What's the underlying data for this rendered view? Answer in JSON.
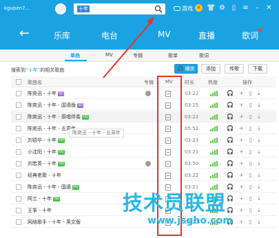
{
  "header": {
    "username": "kgupen7...",
    "search_term": "十年",
    "games_label": "游戏"
  },
  "nav": {
    "items": [
      {
        "label": "乐库"
      },
      {
        "label": "电台"
      },
      {
        "label": "MV"
      },
      {
        "label": "直播"
      },
      {
        "label": "歌词"
      }
    ]
  },
  "subtabs": [
    "单曲",
    "MV",
    "专辑",
    "歌单",
    "歌词"
  ],
  "result_info": {
    "prefix": "搜索到",
    "keyword": "“十年”",
    "suffix": "的相关歌曲"
  },
  "actions": {
    "play": "播放",
    "add": "添加",
    "send": "传歌",
    "download": "下载"
  },
  "table": {
    "headers": {
      "name": "歌曲名",
      "album": "专辑",
      "mv": "MV",
      "duration": "时长",
      "heat": "热度",
      "ops": "操作"
    },
    "rows": [
      {
        "name": "陈奕迅 - 十年",
        "tag": "SQ",
        "album": true,
        "duration": "03:22"
      },
      {
        "name": "陈奕迅 - 十年 - 国语版",
        "tag": "SQ",
        "album": false,
        "duration": "03:25"
      },
      {
        "name": "陈奕迅 - 十年 - 原唱伴奏",
        "tag": "HQ",
        "album": false,
        "duration": "03:22"
      },
      {
        "name": "陈奕迅 - 十年 - 五周年",
        "tag": "",
        "album": false,
        "duration": "05:52"
      },
      {
        "name": "刘德华 - 十年",
        "tag": "HQ",
        "album": false,
        "duration": "03:23"
      },
      {
        "name": "小沈阳 - 十年",
        "tag": "HQ",
        "album": false,
        "duration": "03:21"
      },
      {
        "name": "刘若英 - 十年",
        "tag": "HQ",
        "album": true,
        "duration": "03:50"
      },
      {
        "name": "经典老歌 - 十年",
        "tag": "",
        "album": false,
        "duration": "03:22"
      },
      {
        "name": "陈奕迅 - 十年 - 国语",
        "tag": "HQ",
        "album": false,
        "duration": "03:21"
      },
      {
        "name": "阿兰 - 十年",
        "tag": "HQ",
        "album": false,
        "duration": ""
      },
      {
        "name": "王筝 - 十年",
        "tag": "",
        "album": false,
        "duration": ""
      },
      {
        "name": "网络歌手 - 十年 - 英文版",
        "tag": "",
        "album": false,
        "duration": "03:22"
      }
    ]
  },
  "tooltip": "陈奕迅 - 十年 - 五周年",
  "watermark": {
    "title": "技术员联盟",
    "url": "www.jsgho.com"
  },
  "colors": {
    "primary": "#1aa2e3",
    "highlight": "#e8302a",
    "heat": "#63c34a"
  }
}
